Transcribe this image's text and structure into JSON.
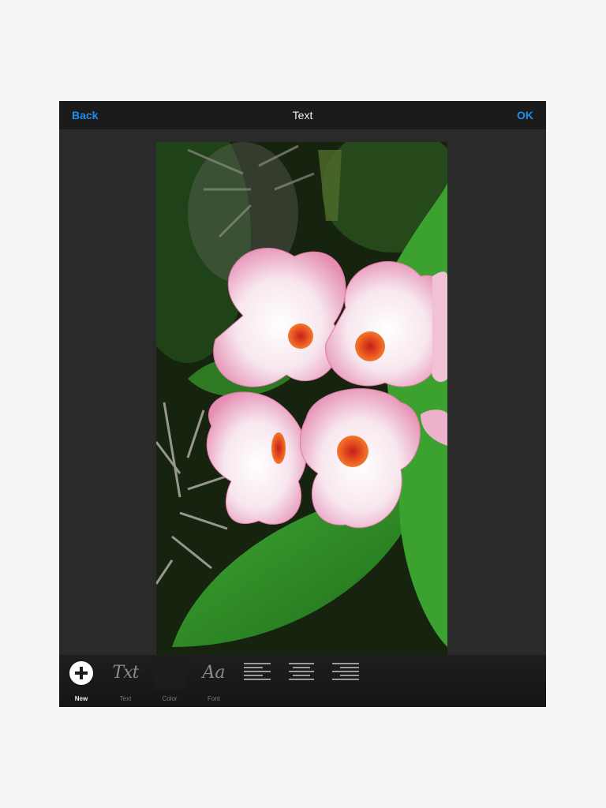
{
  "navbar": {
    "back_label": "Back",
    "title": "Text",
    "ok_label": "OK"
  },
  "colors": {
    "accent": "#1f8ef1",
    "navbar_bg": "#1b1b1b",
    "canvas_bg": "#2a2a2a",
    "toolbar_bg": "#1a1a1a"
  },
  "toolbar": {
    "tools": [
      {
        "label": "New",
        "icon": "plus-circle-icon",
        "active": true
      },
      {
        "label": "Text",
        "icon": "text-txt-icon",
        "glyph": "Txt"
      },
      {
        "label": "Color",
        "icon": "color-swatch-icon"
      },
      {
        "label": "Font",
        "icon": "font-aa-icon",
        "glyph": "Aa"
      },
      {
        "label": "",
        "icon": "align-left-icon"
      },
      {
        "label": "",
        "icon": "align-center-icon"
      },
      {
        "label": "",
        "icon": "align-right-icon"
      }
    ]
  }
}
